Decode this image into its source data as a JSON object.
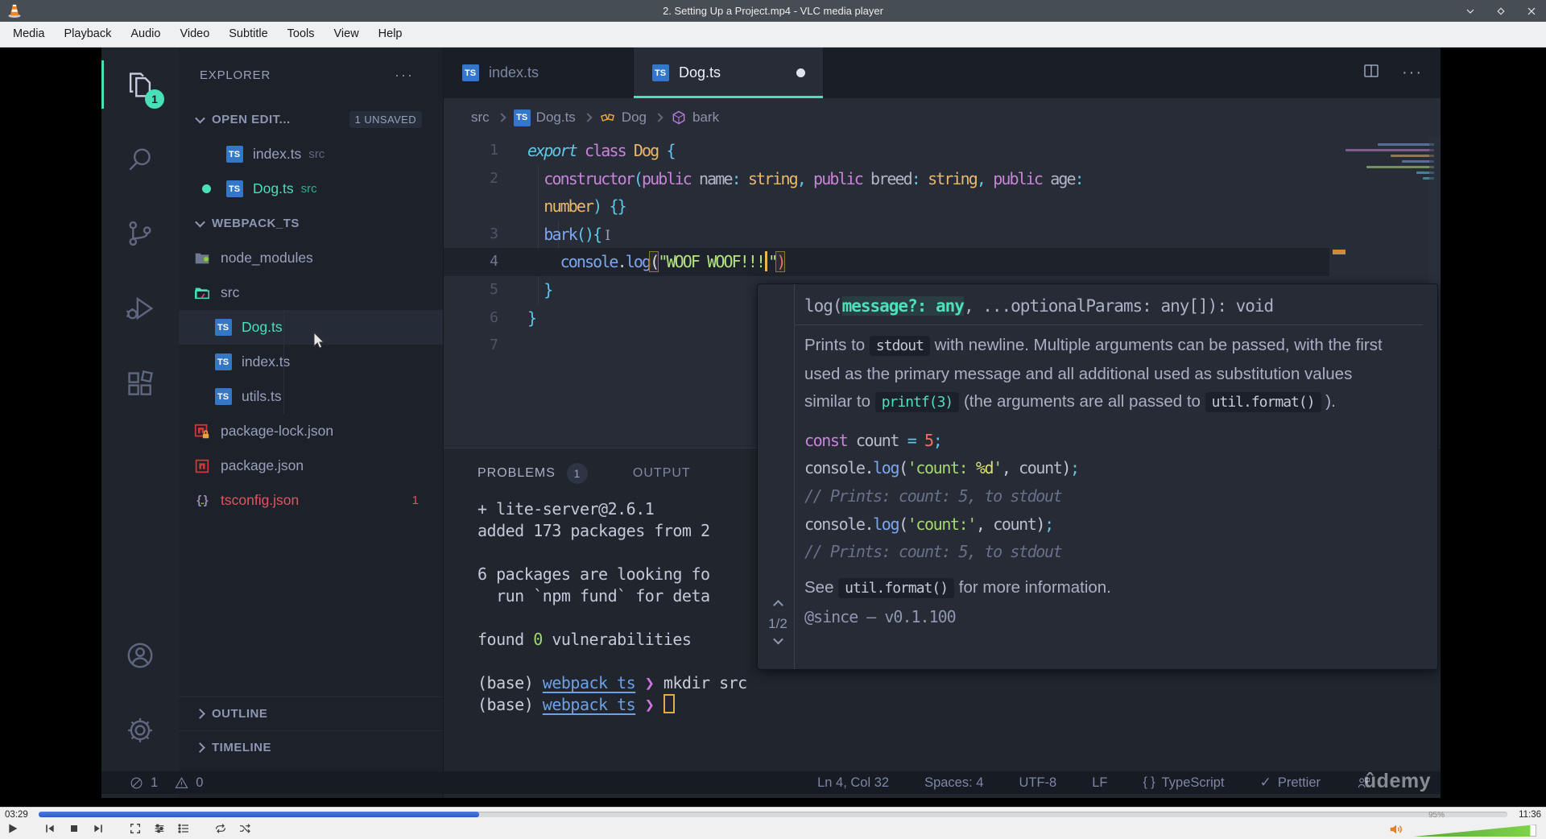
{
  "vlc": {
    "window_title": "2. Setting Up a Project.mp4 - VLC media player",
    "menu_items": [
      "Media",
      "Playback",
      "Audio",
      "Video",
      "Subtitle",
      "Tools",
      "View",
      "Help"
    ],
    "elapsed": "03:29",
    "duration": "11:36",
    "progress_percent": 30,
    "volume_label": "95%",
    "volume_percent": 95
  },
  "vscode": {
    "activity": {
      "files_badge": "1"
    },
    "explorer": {
      "header": "EXPLORER",
      "open_editors_label": "OPEN EDIT...",
      "open_editors_badge": "1 UNSAVED",
      "open_editors": [
        {
          "name": "index.ts",
          "detail": "src",
          "modified": false
        },
        {
          "name": "Dog.ts",
          "detail": "src",
          "modified": true
        }
      ],
      "workspace_label": "WEBPACK_TS",
      "tree": [
        {
          "name": "node_modules",
          "icon": "folder-node",
          "depth": 0
        },
        {
          "name": "src",
          "icon": "folder-src",
          "depth": 0
        },
        {
          "name": "Dog.ts",
          "icon": "ts",
          "depth": 1,
          "selected": true,
          "teal": true
        },
        {
          "name": "index.ts",
          "icon": "ts",
          "depth": 1
        },
        {
          "name": "utils.ts",
          "icon": "ts",
          "depth": 1
        },
        {
          "name": "package-lock.json",
          "icon": "npm-lock",
          "depth": 0
        },
        {
          "name": "package.json",
          "icon": "npm",
          "depth": 0
        },
        {
          "name": "tsconfig.json",
          "icon": "json",
          "depth": 0,
          "error": true,
          "badge": "1"
        }
      ],
      "outline_label": "OUTLINE",
      "timeline_label": "TIMELINE"
    },
    "tabs": [
      {
        "label": "index.ts",
        "active": false,
        "dirty": false
      },
      {
        "label": "Dog.ts",
        "active": true,
        "dirty": true
      }
    ],
    "breadcrumbs": [
      {
        "label": "src",
        "icon": ""
      },
      {
        "label": "Dog.ts",
        "icon": "ts"
      },
      {
        "label": "Dog",
        "icon": "class"
      },
      {
        "label": "bark",
        "icon": "method"
      }
    ],
    "editor": {
      "rows": [
        {
          "num": "1",
          "tokens": [
            {
              "t": "export",
              "c": "kwi"
            },
            {
              "t": " ",
              "c": "plain"
            },
            {
              "t": "class",
              "c": "kw"
            },
            {
              "t": " ",
              "c": "plain"
            },
            {
              "t": "Dog",
              "c": "type"
            },
            {
              "t": " ",
              "c": "plain"
            },
            {
              "t": "{",
              "c": "punct"
            }
          ]
        },
        {
          "num": "2",
          "tokens": [
            {
              "t": "  ",
              "c": "plain"
            },
            {
              "t": "constructor",
              "c": "kw"
            },
            {
              "t": "(",
              "c": "punct"
            },
            {
              "t": "public",
              "c": "kw"
            },
            {
              "t": " name",
              "c": "id"
            },
            {
              "t": ":",
              "c": "punct"
            },
            {
              "t": " string",
              "c": "type"
            },
            {
              "t": ",",
              "c": "punct"
            },
            {
              "t": " public",
              "c": "kw"
            },
            {
              "t": " breed",
              "c": "id"
            },
            {
              "t": ":",
              "c": "punct"
            },
            {
              "t": " string",
              "c": "type"
            },
            {
              "t": ",",
              "c": "punct"
            },
            {
              "t": " public",
              "c": "kw"
            },
            {
              "t": " age",
              "c": "id"
            },
            {
              "t": ":",
              "c": "punct"
            }
          ]
        },
        {
          "num": "",
          "tokens": [
            {
              "t": "  ",
              "c": "plain"
            },
            {
              "t": "number",
              "c": "type"
            },
            {
              "t": ") {}",
              "c": "punct"
            }
          ]
        },
        {
          "num": "3",
          "tokens": [
            {
              "t": "  ",
              "c": "plain"
            },
            {
              "t": "bark",
              "c": "fn"
            },
            {
              "t": "(){",
              "c": "punct"
            },
            {
              "t": "I",
              "c": "ibeam"
            }
          ]
        },
        {
          "num": "4",
          "highlight": true,
          "tokens": [
            {
              "t": "    ",
              "c": "plain"
            },
            {
              "t": "console",
              "c": "fn"
            },
            {
              "t": ".",
              "c": "plain"
            },
            {
              "t": "log",
              "c": "fn"
            },
            {
              "t": "(",
              "c": "brkty"
            },
            {
              "t": "\"WOOF WOOF!!!",
              "c": "str"
            },
            {
              "t": "",
              "c": "cursor"
            },
            {
              "t": "\"",
              "c": "str"
            },
            {
              "t": ")",
              "c": "brktr"
            }
          ]
        },
        {
          "num": "5",
          "tokens": [
            {
              "t": "  ",
              "c": "plain"
            },
            {
              "t": "}",
              "c": "punct"
            }
          ]
        },
        {
          "num": "6",
          "tokens": [
            {
              "t": "}",
              "c": "punct"
            }
          ]
        },
        {
          "num": "7",
          "tokens": []
        }
      ]
    },
    "hover": {
      "signature_tokens": [
        {
          "t": "log(",
          "c": "sig"
        },
        {
          "t": "message?: any",
          "c": "sigparam"
        },
        {
          "t": ", ...optionalParams: any[]): void",
          "c": "sig"
        }
      ],
      "description": [
        {
          "t": "Prints to "
        },
        {
          "chip": "stdout"
        },
        {
          "t": " with newline. Multiple arguments can be passed, with the first used as the primary message and all additional used as substitution values similar to "
        },
        {
          "chip": "printf(3)",
          "accent": true
        },
        {
          "t": " (the arguments are all passed to "
        },
        {
          "chip": "util.format()"
        },
        {
          "t": " )."
        }
      ],
      "code_lines": [
        [
          {
            "t": "const",
            "c": "kw"
          },
          {
            "t": " count ",
            "c": "id2"
          },
          {
            "t": "=",
            "c": "punct"
          },
          {
            "t": " ",
            "c": "plain"
          },
          {
            "t": "5",
            "c": "num"
          },
          {
            "t": ";",
            "c": "punct"
          }
        ],
        [
          {
            "t": "console",
            "c": "id2"
          },
          {
            "t": ".",
            "c": "plain"
          },
          {
            "t": "log",
            "c": "fn"
          },
          {
            "t": "(",
            "c": "plain"
          },
          {
            "t": "'count: ",
            "c": "str2"
          },
          {
            "t": "%d",
            "c": "fmt"
          },
          {
            "t": "'",
            "c": "str2"
          },
          {
            "t": ", ",
            "c": "plain"
          },
          {
            "t": "count",
            "c": "id2"
          },
          {
            "t": ")",
            "c": "plain"
          },
          {
            "t": ";",
            "c": "punct"
          }
        ],
        [
          {
            "t": "// Prints: count: 5, to stdout",
            "c": "cmt"
          }
        ],
        [
          {
            "t": "console",
            "c": "id2"
          },
          {
            "t": ".",
            "c": "plain"
          },
          {
            "t": "log",
            "c": "fn"
          },
          {
            "t": "(",
            "c": "plain"
          },
          {
            "t": "'count:'",
            "c": "str2"
          },
          {
            "t": ", ",
            "c": "plain"
          },
          {
            "t": "count",
            "c": "id2"
          },
          {
            "t": ")",
            "c": "plain"
          },
          {
            "t": ";",
            "c": "punct"
          }
        ],
        [
          {
            "t": "// Prints: count: 5, to stdout",
            "c": "cmt"
          }
        ]
      ],
      "see_line": [
        {
          "t": "See "
        },
        {
          "chip": "util.format()"
        },
        {
          "t": " for more information."
        }
      ],
      "since_line": "@since — v0.1.100",
      "pager": "1/2"
    },
    "panel": {
      "tabs": [
        {
          "label": "PROBLEMS",
          "badge": "1"
        },
        {
          "label": "OUTPUT"
        }
      ],
      "terminal": [
        [
          {
            "t": "+ lite-server@2.6.1"
          }
        ],
        [
          {
            "t": "added 173 packages from 2"
          }
        ],
        [],
        [
          {
            "t": "6 packages are looking fo"
          }
        ],
        [
          {
            "t": "  run `npm fund` for deta"
          }
        ],
        [],
        [
          {
            "t": "found "
          },
          {
            "t": "0",
            "c": "green"
          },
          {
            "t": " vulnerabilities"
          }
        ],
        [],
        [
          {
            "t": "(base) ",
            "c": "dim"
          },
          {
            "t": "webpack_ts",
            "c": "path"
          },
          {
            "t": " ❯ ",
            "c": "prompt"
          },
          {
            "t": "mkdir src",
            "c": "dim"
          }
        ],
        [
          {
            "t": "(base) ",
            "c": "dim"
          },
          {
            "t": "webpack_ts",
            "c": "path"
          },
          {
            "t": " ❯ ",
            "c": "prompt"
          },
          {
            "t": "",
            "c": "tcursor"
          }
        ]
      ]
    },
    "status": {
      "errors": "1",
      "warnings": "0",
      "items": [
        {
          "icon": "",
          "label": "Ln 4, Col 32"
        },
        {
          "icon": "",
          "label": "Spaces: 4"
        },
        {
          "icon": "",
          "label": "UTF-8"
        },
        {
          "icon": "",
          "label": "LF"
        },
        {
          "icon": "braces",
          "label": "TypeScript"
        },
        {
          "icon": "check",
          "label": "Prettier"
        },
        {
          "icon": "feedback",
          "label": ""
        }
      ]
    },
    "watermark": "ûdemy"
  }
}
